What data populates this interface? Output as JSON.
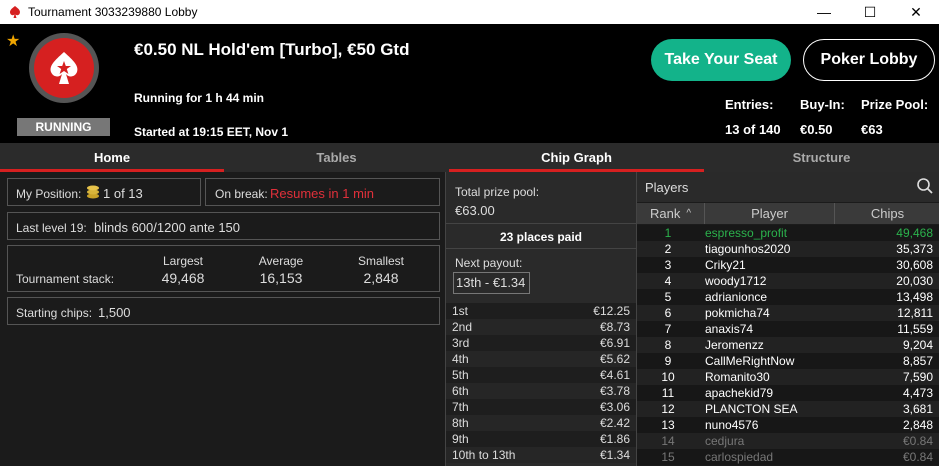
{
  "window": {
    "title": "Tournament 3033239880 Lobby",
    "minimize": "—",
    "maximize": "☐",
    "close": "✕"
  },
  "header": {
    "title": "€0.50 NL Hold'em [Turbo], €50 Gtd",
    "running_for": "Running for 1 h 44 min",
    "started_at": "Started at 19:15 EET, Nov 1",
    "status_badge": "RUNNING",
    "take_seat": "Take Your Seat",
    "poker_lobby": "Poker Lobby",
    "entries_label": "Entries:",
    "entries_value": "13 of 140",
    "buyin_label": "Buy-In:",
    "buyin_value": "€0.50",
    "prizepool_label": "Prize Pool:",
    "prizepool_value": "€63"
  },
  "tabs": [
    "Home",
    "Tables",
    "Chip Graph",
    "Structure"
  ],
  "home": {
    "my_position_label": "My Position:",
    "my_position_value": "1 of 13",
    "on_break_label": "On break:",
    "on_break_value": "Resumes in 1 min",
    "last_level_label": "Last level 19:",
    "last_level_value": "blinds 600/1200 ante 150",
    "stack_label": "Tournament stack:",
    "largest_label": "Largest",
    "largest_value": "49,468",
    "average_label": "Average",
    "average_value": "16,153",
    "smallest_label": "Smallest",
    "smallest_value": "2,848",
    "starting_chips_label": "Starting chips:",
    "starting_chips_value": "1,500"
  },
  "prizes": {
    "total_label": "Total prize pool:",
    "total_value": "€63.00",
    "places_paid": "23 places paid",
    "next_payout_label": "Next payout:",
    "next_payout_value": "13th - €1.34",
    "payouts": [
      {
        "place": "1st",
        "amount": "€12.25"
      },
      {
        "place": "2nd",
        "amount": "€8.73"
      },
      {
        "place": "3rd",
        "amount": "€6.91"
      },
      {
        "place": "4th",
        "amount": "€5.62"
      },
      {
        "place": "5th",
        "amount": "€4.61"
      },
      {
        "place": "6th",
        "amount": "€3.78"
      },
      {
        "place": "7th",
        "amount": "€3.06"
      },
      {
        "place": "8th",
        "amount": "€2.42"
      },
      {
        "place": "9th",
        "amount": "€1.86"
      },
      {
        "place": "10th to 13th",
        "amount": "€1.34"
      }
    ]
  },
  "players": {
    "title": "Players",
    "col_rank": "Rank",
    "col_player": "Player",
    "col_chips": "Chips",
    "rows": [
      {
        "rank": "1",
        "name": "espresso_profit",
        "chips": "49,468",
        "state": "me"
      },
      {
        "rank": "2",
        "name": "tiagounhos2020",
        "chips": "35,373",
        "state": ""
      },
      {
        "rank": "3",
        "name": "Criky21",
        "chips": "30,608",
        "state": ""
      },
      {
        "rank": "4",
        "name": "woody1712",
        "chips": "20,030",
        "state": ""
      },
      {
        "rank": "5",
        "name": "adrianionce",
        "chips": "13,498",
        "state": ""
      },
      {
        "rank": "6",
        "name": "pokmicha74",
        "chips": "12,811",
        "state": ""
      },
      {
        "rank": "7",
        "name": "anaxis74",
        "chips": "11,559",
        "state": ""
      },
      {
        "rank": "8",
        "name": "Jeromenzz",
        "chips": "9,204",
        "state": ""
      },
      {
        "rank": "9",
        "name": "CallMeRightNow",
        "chips": "8,857",
        "state": ""
      },
      {
        "rank": "10",
        "name": "Romanito30",
        "chips": "7,590",
        "state": ""
      },
      {
        "rank": "11",
        "name": "apachekid79",
        "chips": "4,473",
        "state": ""
      },
      {
        "rank": "12",
        "name": "PLANCTON SEA",
        "chips": "3,681",
        "state": ""
      },
      {
        "rank": "13",
        "name": "nuno4576",
        "chips": "2,848",
        "state": ""
      },
      {
        "rank": "14",
        "name": "cedjura",
        "chips": "€0.84",
        "state": "out"
      },
      {
        "rank": "15",
        "name": "carlospiedad",
        "chips": "€0.84",
        "state": "out"
      }
    ]
  },
  "colors": {
    "accent_red": "#d62020",
    "seat_green": "#13b38a",
    "me_green": "#2bb24c",
    "warning_red": "#e0303a"
  }
}
